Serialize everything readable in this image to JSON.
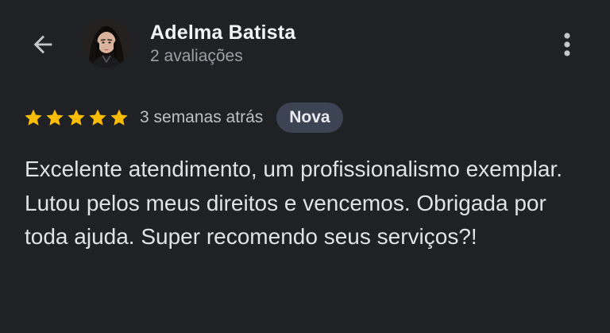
{
  "header": {
    "back_icon": "arrow-left-icon",
    "more_icon": "more-vert-icon",
    "reviewer": {
      "name": "Adelma Batista",
      "review_count": "2 avaliações"
    }
  },
  "review": {
    "rating": 5,
    "rating_max": 5,
    "star_color": "#fbbc04",
    "date": "3 semanas atrás",
    "badge": "Nova",
    "text": "Excelente atendimento, um profissionalismo exemplar. Lutou pelos meus direitos e vencemos. Obrigada por toda ajuda. Super recomendo seus serviços?!"
  }
}
